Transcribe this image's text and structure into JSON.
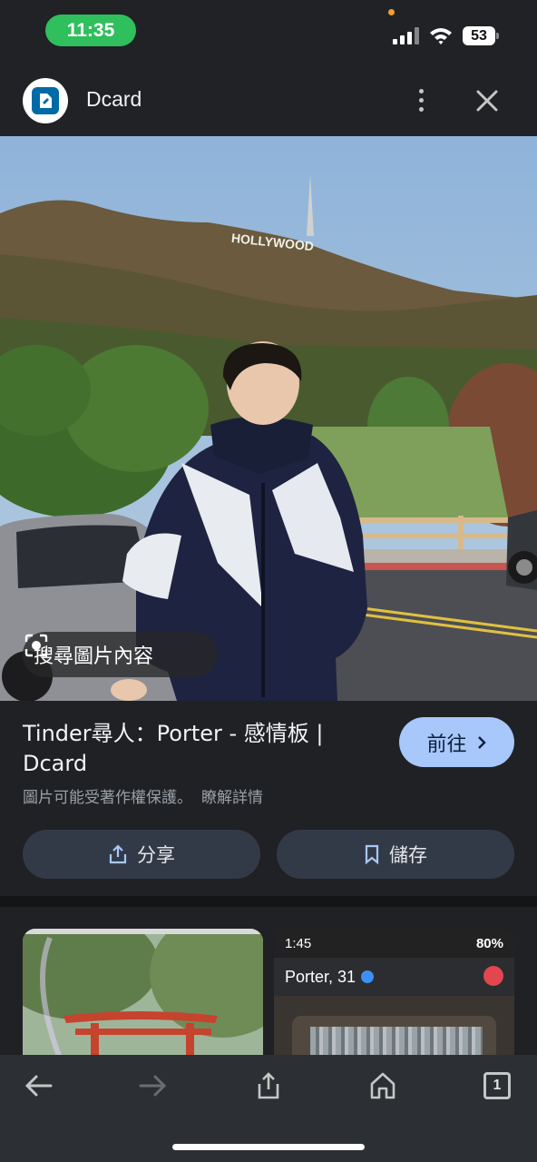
{
  "status_bar": {
    "time": "11:35",
    "battery": "53"
  },
  "header": {
    "site_name": "Dcard",
    "icons": [
      "site-logo",
      "more-vert-icon",
      "close-icon"
    ]
  },
  "hero_image": {
    "search_chip_label": "搜尋圖片內容",
    "sign_text": "HOLLYWOOD"
  },
  "result": {
    "title": "Tinder尋人：Porter - 感情板 | Dcard",
    "visit_label": "前往",
    "copyright_note": "圖片可能受著作權保護。",
    "learn_more": "瞭解詳情",
    "share_label": "分享",
    "save_label": "儲存"
  },
  "related": {
    "screenshot_time": "1:45",
    "screenshot_battery": "80%",
    "screenshot_name": "Porter, 31"
  },
  "toolbar": {
    "tab_count": "1",
    "icons": [
      "back-arrow-icon",
      "forward-arrow-icon",
      "share-icon",
      "home-icon",
      "tabs-icon"
    ]
  },
  "colors": {
    "accent": "#a8c7fa",
    "status_pill": "#2fbf5c",
    "background": "#1f2125"
  }
}
